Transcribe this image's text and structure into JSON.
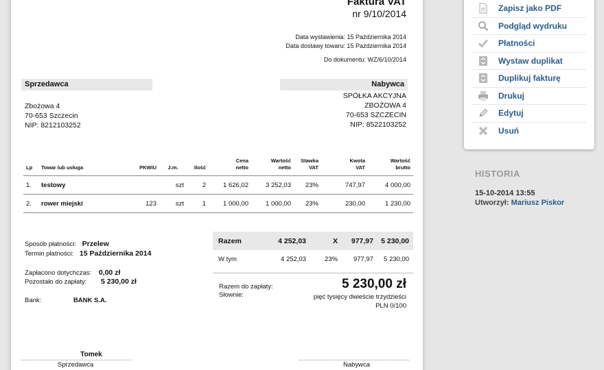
{
  "invoice": {
    "title": "Faktura VAT",
    "number": "nr 9/10/2014",
    "issue_date": "Data wystawienia: 15 Października 2014",
    "delivery_date": "Data dostawy towaru: 15 Października 2014",
    "doc_ref": "Do dokumentu: WZ/6/10/2014"
  },
  "seller": {
    "header": "Sprzedawca",
    "line1": "Zbożowa 4",
    "line2": "70-653 Szczecin",
    "line3": "NIP: 8212103252"
  },
  "buyer": {
    "header": "Nabywca",
    "line1": "SPÓŁKA AKCYJNA",
    "line2": "ZBOŻOWA 4",
    "line3": "70-653 SZCZECIN",
    "line4": "NIP: 8522103252"
  },
  "table": {
    "headers": {
      "lp": "Lp",
      "name": "Towar lub usługa",
      "pkwiu": "PKWiU",
      "unit": "J.m.",
      "qty": "Ilość",
      "price1": "Cena",
      "price2": "netto",
      "net1": "Wartość",
      "net2": "netto",
      "rate1": "Stawka",
      "rate2": "VAT",
      "vat1": "Kwota",
      "vat2": "VAT",
      "gross1": "Wartość",
      "gross2": "brutto"
    },
    "rows": [
      {
        "lp": "1.",
        "name": "testowy",
        "pkwiu": "",
        "unit": "szt",
        "qty": "2",
        "price": "1 626,02",
        "net": "3 252,03",
        "rate": "23%",
        "vat": "747,97",
        "gross": "4 000,00"
      },
      {
        "lp": "2.",
        "name": "rower miejski",
        "pkwiu": "123",
        "unit": "szt",
        "qty": "1",
        "price": "1 000,00",
        "net": "1 000,00",
        "rate": "23%",
        "vat": "230,00",
        "gross": "1 230,00"
      }
    ]
  },
  "payment": {
    "method_label": "Sposób płatności:",
    "method": "Przelew",
    "due_label": "Termin płatności:",
    "due": "15 Października 2014",
    "paid_label": "Zapłacono dotychczas:",
    "paid": "0,00 zł",
    "remaining_label": "Pozostało do zapłaty:",
    "remaining": "5 230,00 zł",
    "bank_label": "Bank:",
    "bank": "BANK S.A."
  },
  "summary": {
    "total_label": "Razem",
    "total_net": "4 252,03",
    "total_rate": "X",
    "total_vat": "977,97",
    "total_gross": "5 230,00",
    "including_label": "W tym",
    "incl_net": "4 252,03",
    "incl_rate": "23%",
    "incl_vat": "977,97",
    "incl_gross": "5 230,00",
    "to_pay_label": "Razem do zapłaty:",
    "in_words_label": "Słownie:",
    "to_pay": "5 230,00 zł",
    "in_words": "pięć tysięcy dwieście trzydzieści",
    "in_words_fraction": "PLN 0/100"
  },
  "signatures": {
    "seller_name": "Tomek",
    "seller_label": "Sprzedawca",
    "buyer_label": "Nabywca"
  },
  "actions": [
    {
      "label": "Zapisz jako PDF",
      "icon": "pdf-icon"
    },
    {
      "label": "Podgląd wydruku",
      "icon": "magnifier-icon"
    },
    {
      "label": "Płatności",
      "icon": "checkmark-icon"
    },
    {
      "label": "Wystaw duplikat",
      "icon": "duplicate-icon"
    },
    {
      "label": "Duplikuj fakturę",
      "icon": "duplicate-icon"
    },
    {
      "label": "Drukuj",
      "icon": "printer-icon"
    },
    {
      "label": "Edytuj",
      "icon": "pencil-icon"
    },
    {
      "label": "Usuń",
      "icon": "delete-icon"
    }
  ],
  "history": {
    "title": "HISTORIA",
    "date": "15-10-2014 13:55",
    "created_label": "Utworzył:",
    "created_by": "Mariusz Piskor"
  },
  "colors": {
    "link": "#2a5b8a",
    "header_bg": "#e8e8e8",
    "page_bg": "#e6e6e6"
  }
}
